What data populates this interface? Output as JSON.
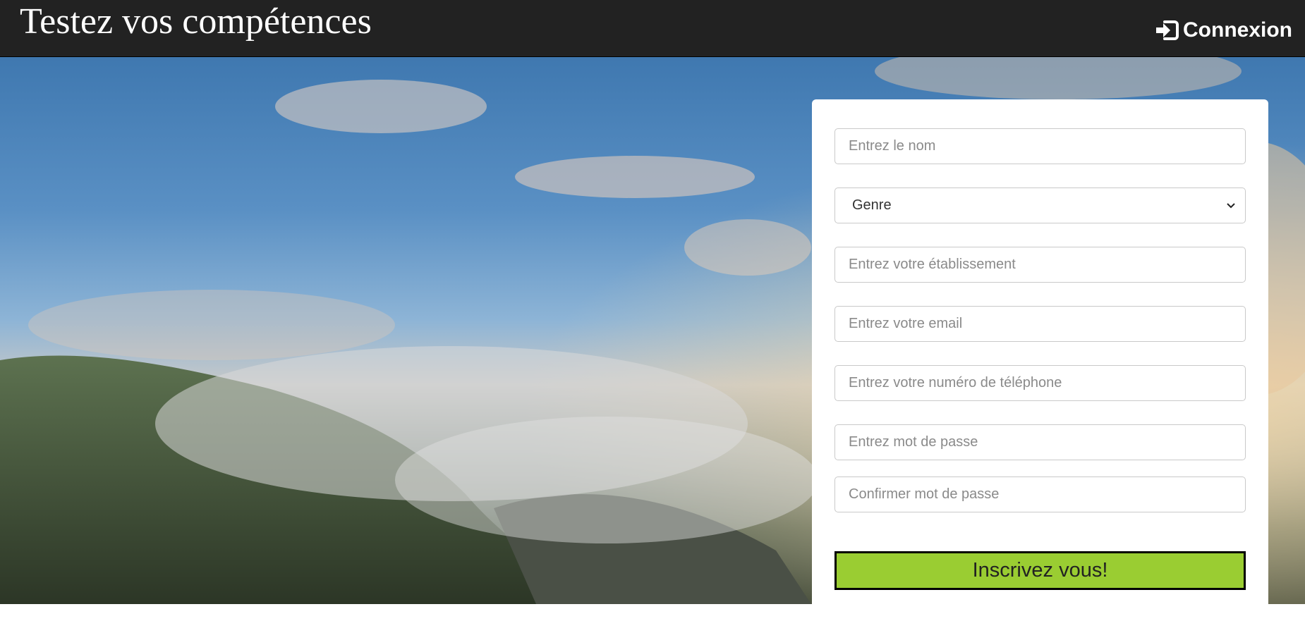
{
  "header": {
    "title": "Testez vos compétences",
    "login_label": "Connexion",
    "login_icon": "sign-in-icon"
  },
  "form": {
    "name_placeholder": "Entrez le nom",
    "gender_selected": "Genre",
    "institution_placeholder": "Entrez votre établissement",
    "email_placeholder": "Entrez votre email",
    "phone_placeholder": "Entrez votre numéro de téléphone",
    "password_placeholder": "Entrez mot de passe",
    "confirm_placeholder": "Confirmer mot de passe",
    "submit_label": "Inscrivez vous!"
  },
  "colors": {
    "navbar": "#222222",
    "submit": "#9acd32"
  }
}
